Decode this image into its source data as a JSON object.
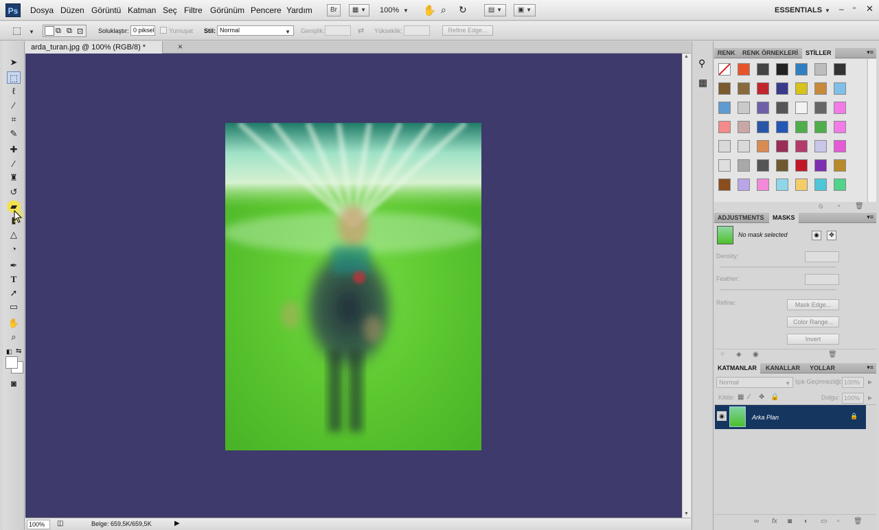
{
  "menubar": {
    "logo": "Ps",
    "items": [
      "Dosya",
      "Düzen",
      "Görüntü",
      "Katman",
      "Seç",
      "Filtre",
      "Görünüm",
      "Pencere",
      "Yardım"
    ],
    "bridge_label": "Br",
    "zoom": "100%",
    "workspace": "ESSENTIALS"
  },
  "options": {
    "feather_label": "Soluklaştır:",
    "feather_value": "0 piksel",
    "antialias_label": "Yumuşat",
    "style_label": "Stil:",
    "style_value": "Normal",
    "width_label": "Genişlik:",
    "height_label": "Yükseklik:",
    "refine_edge": "Refine Edge..."
  },
  "document": {
    "tab_title": "arda_turan.jpg @ 100% (RGB/8) *",
    "close_glyph": "×"
  },
  "status": {
    "zoom": "100%",
    "doc_size": "Belge: 659,5K/659,5K"
  },
  "styles_panel": {
    "tabs": [
      "RENK",
      "RENK ÖRNEKLERİ",
      "STİLLER"
    ],
    "active_tab": "STİLLER"
  },
  "adjustments_panel": {
    "tabs": [
      "ADJUSTMENTS",
      "MASKS"
    ],
    "active_tab": "MASKS",
    "no_mask": "No mask selected",
    "density_label": "Density:",
    "feather_label": "Feather:",
    "refine_label": "Refine:",
    "mask_edge": "Mask Edge...",
    "color_range": "Color Range...",
    "invert": "Invert"
  },
  "layers_panel": {
    "tabs": [
      "KATMANLAR",
      "KANALLAR",
      "YOLLAR"
    ],
    "active_tab": "KATMANLAR",
    "blend_mode": "Normal",
    "opacity_label": "Işık Geçirmezliği:",
    "opacity_value": "100%",
    "lock_label": "Kilitle:",
    "fill_label": "Dolgu:",
    "fill_value": "100%",
    "layer_name": "Arka Plan"
  },
  "colors": {
    "canvas_bg": "#3e3a6b",
    "layer_selected": "#15365f",
    "photo_green": "#5ec930"
  }
}
